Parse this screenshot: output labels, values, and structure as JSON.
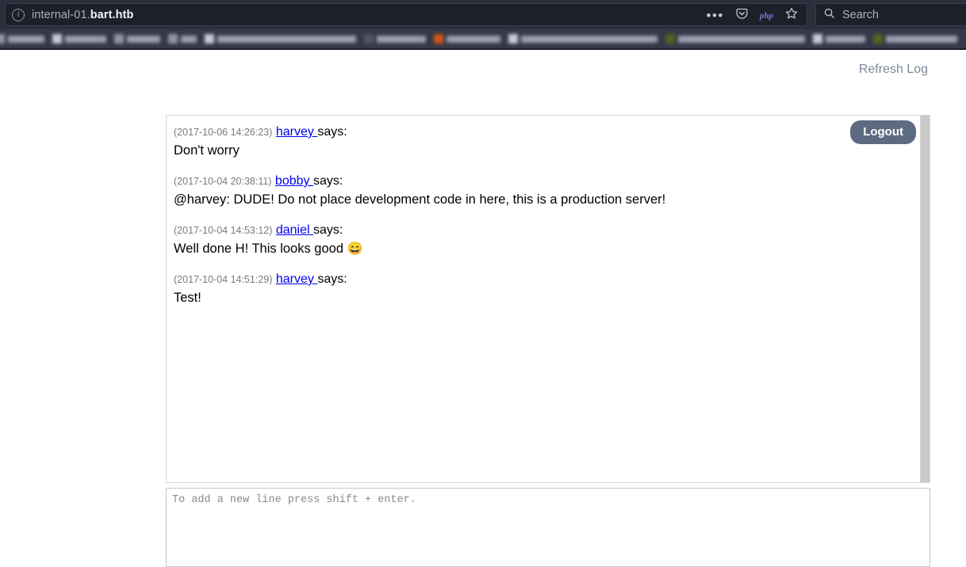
{
  "browser": {
    "url_prefix": "internal-01.",
    "url_host": "bart.htb",
    "info_icon": "info-circle-icon",
    "ellipsis_label": "•••",
    "pocket_icon": "pocket-icon",
    "php_badge": "php",
    "bookmark_star_icon": "star-icon",
    "search_icon": "search-icon",
    "search_placeholder": "Search",
    "bookmarks_note": "bookmarks-bar-blurred"
  },
  "page": {
    "refresh_log_label": "Refresh Log",
    "logout_label": "Logout",
    "input_placeholder": "To add a new line press shift + enter.",
    "messages": [
      {
        "time": "(2017-10-06 14:26:23)",
        "user": "harvey",
        "says": "says:",
        "body": "Don't worry",
        "emoji": ""
      },
      {
        "time": "(2017-10-04 20:38:11)",
        "user": "bobby",
        "says": "says:",
        "body": "@harvey: DUDE! Do not place development code in here, this is a production server!",
        "emoji": ""
      },
      {
        "time": "(2017-10-04 14:53:12)",
        "user": "daniel",
        "says": "says:",
        "body": "Well done H! This looks good ",
        "emoji": "😄"
      },
      {
        "time": "(2017-10-04 14:51:29)",
        "user": "harvey",
        "says": "says:",
        "body": "Test!",
        "emoji": ""
      }
    ]
  },
  "colors": {
    "chrome_bg": "#2b2e3b",
    "urlbar_bg": "#1d2029",
    "link_blue": "#0000ee",
    "logout_bg": "#5d6b82",
    "refresh_link": "#7c8699"
  }
}
